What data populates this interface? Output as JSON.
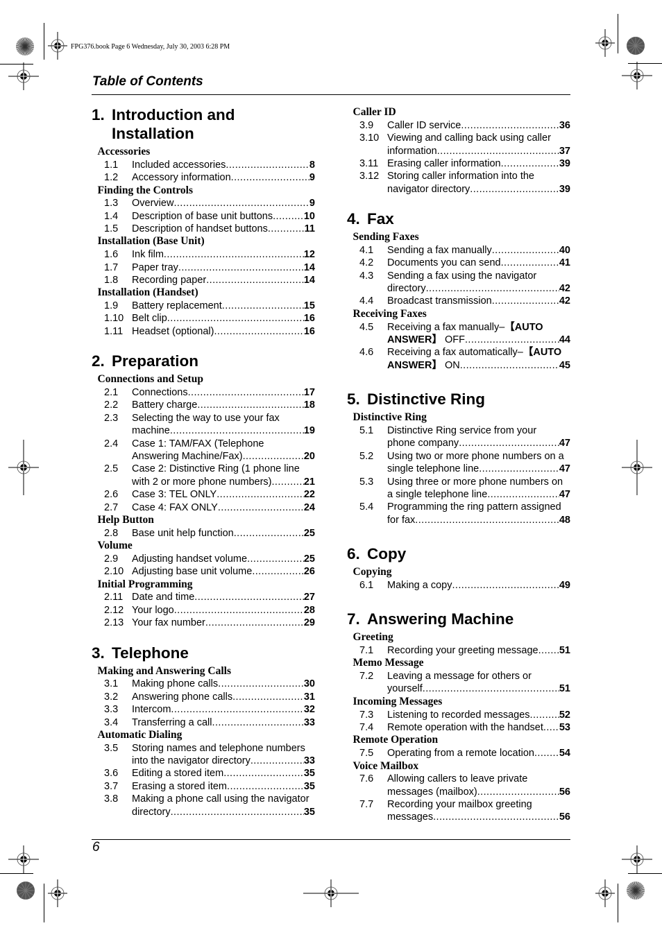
{
  "slug": "FPG376.book  Page 6  Wednesday, July 30, 2003  6:28 PM",
  "header": {
    "title": "Table of Contents"
  },
  "footer": {
    "page_number": "6"
  },
  "chapters": [
    {
      "number": "1.",
      "title_lines": [
        "Introduction and",
        "Installation"
      ],
      "sections": [
        {
          "title": "Accessories",
          "entries": [
            {
              "num": "1.1",
              "lines": [
                "Included accessories"
              ],
              "page": "8"
            },
            {
              "num": "1.2",
              "lines": [
                "Accessory information"
              ],
              "page": "9"
            }
          ]
        },
        {
          "title": "Finding the Controls",
          "entries": [
            {
              "num": "1.3",
              "lines": [
                "Overview"
              ],
              "page": "9"
            },
            {
              "num": "1.4",
              "lines": [
                "Description of base unit buttons"
              ],
              "page": "10"
            },
            {
              "num": "1.5",
              "lines": [
                "Description of handset buttons"
              ],
              "page": "11"
            }
          ]
        },
        {
          "title": "Installation (Base Unit)",
          "entries": [
            {
              "num": "1.6",
              "lines": [
                "Ink film"
              ],
              "page": "12"
            },
            {
              "num": "1.7",
              "lines": [
                "Paper tray"
              ],
              "page": "14"
            },
            {
              "num": "1.8",
              "lines": [
                "Recording paper"
              ],
              "page": "14"
            }
          ]
        },
        {
          "title": "Installation (Handset)",
          "entries": [
            {
              "num": "1.9",
              "lines": [
                "Battery replacement"
              ],
              "page": "15"
            },
            {
              "num": "1.10",
              "lines": [
                "Belt clip"
              ],
              "page": "16"
            },
            {
              "num": "1.11",
              "lines": [
                "Headset (optional)"
              ],
              "page": "16"
            }
          ]
        }
      ]
    },
    {
      "number": "2.",
      "title_lines": [
        "Preparation"
      ],
      "sections": [
        {
          "title": "Connections and Setup",
          "entries": [
            {
              "num": "2.1",
              "lines": [
                "Connections"
              ],
              "page": "17"
            },
            {
              "num": "2.2",
              "lines": [
                "Battery charge"
              ],
              "page": "18"
            },
            {
              "num": "2.3",
              "lines": [
                "Selecting the way to use your fax",
                "machine"
              ],
              "page": "19"
            },
            {
              "num": "2.4",
              "lines": [
                "Case 1: TAM/FAX (Telephone",
                "Answering Machine/Fax)"
              ],
              "page": "20"
            },
            {
              "num": "2.5",
              "lines": [
                "Case 2: Distinctive Ring (1 phone line",
                "with 2 or more phone numbers)"
              ],
              "page": "21"
            },
            {
              "num": "2.6",
              "lines": [
                "Case 3: TEL ONLY"
              ],
              "page": "22"
            },
            {
              "num": "2.7",
              "lines": [
                "Case 4: FAX ONLY"
              ],
              "page": "24"
            }
          ]
        },
        {
          "title": "Help Button",
          "entries": [
            {
              "num": "2.8",
              "lines": [
                "Base unit help function"
              ],
              "page": "25"
            }
          ]
        },
        {
          "title": "Volume",
          "entries": [
            {
              "num": "2.9",
              "lines": [
                "Adjusting handset volume"
              ],
              "page": "25"
            },
            {
              "num": "2.10",
              "lines": [
                "Adjusting base unit volume"
              ],
              "page": "26"
            }
          ]
        },
        {
          "title": "Initial Programming",
          "entries": [
            {
              "num": "2.11",
              "lines": [
                "Date and time"
              ],
              "page": "27"
            },
            {
              "num": "2.12",
              "lines": [
                "Your logo"
              ],
              "page": "28"
            },
            {
              "num": "2.13",
              "lines": [
                "Your fax number"
              ],
              "page": "29"
            }
          ]
        }
      ]
    },
    {
      "number": "3.",
      "title_lines": [
        "Telephone"
      ],
      "sections": [
        {
          "title": "Making and Answering Calls",
          "entries": [
            {
              "num": "3.1",
              "lines": [
                "Making phone calls"
              ],
              "page": "30"
            },
            {
              "num": "3.2",
              "lines": [
                "Answering phone calls"
              ],
              "page": "31"
            },
            {
              "num": "3.3",
              "lines": [
                "Intercom"
              ],
              "page": "32"
            },
            {
              "num": "3.4",
              "lines": [
                "Transferring a call"
              ],
              "page": "33"
            }
          ]
        },
        {
          "title": "Automatic Dialing",
          "entries": [
            {
              "num": "3.5",
              "lines": [
                "Storing names and telephone numbers",
                "into the navigator directory"
              ],
              "page": "33"
            },
            {
              "num": "3.6",
              "lines": [
                "Editing a stored item"
              ],
              "page": "35"
            },
            {
              "num": "3.7",
              "lines": [
                "Erasing a stored item"
              ],
              "page": "35"
            },
            {
              "num": "3.8",
              "lines": [
                "Making a phone call using the navigator",
                "directory"
              ],
              "page": "35"
            }
          ]
        },
        {
          "title": "Caller ID",
          "entries": [
            {
              "num": "3.9",
              "lines": [
                "Caller ID service"
              ],
              "page": "36"
            },
            {
              "num": "3.10",
              "lines": [
                "Viewing and calling back using caller",
                "information"
              ],
              "page": "37"
            },
            {
              "num": "3.11",
              "lines": [
                "Erasing caller information"
              ],
              "page": "39"
            },
            {
              "num": "3.12",
              "lines": [
                "Storing caller information into the",
                "navigator directory"
              ],
              "page": "39"
            }
          ]
        }
      ]
    },
    {
      "number": "4.",
      "title_lines": [
        "Fax"
      ],
      "sections": [
        {
          "title": "Sending Faxes",
          "entries": [
            {
              "num": "4.1",
              "lines": [
                "Sending a fax manually"
              ],
              "page": "40"
            },
            {
              "num": "4.2",
              "lines": [
                "Documents you can send"
              ],
              "page": "41"
            },
            {
              "num": "4.3",
              "lines": [
                "Sending a fax using the navigator",
                "directory"
              ],
              "page": "42"
            },
            {
              "num": "4.4",
              "lines": [
                "Broadcast transmission"
              ],
              "page": "42"
            }
          ]
        },
        {
          "title": "Receiving Faxes",
          "entries": [
            {
              "num": "4.5",
              "lines": [
                "Receiving a fax manually–{AUTO",
                "ANSWER} OFF"
              ],
              "page": "44"
            },
            {
              "num": "4.6",
              "lines": [
                "Receiving a fax automatically–{AUTO",
                "ANSWER} ON"
              ],
              "page": "45"
            }
          ]
        }
      ]
    },
    {
      "number": "5.",
      "title_lines": [
        "Distinctive Ring"
      ],
      "sections": [
        {
          "title": "Distinctive Ring",
          "entries": [
            {
              "num": "5.1",
              "lines": [
                "Distinctive Ring service from your",
                "phone company"
              ],
              "page": "47"
            },
            {
              "num": "5.2",
              "lines": [
                "Using two or more phone numbers on a",
                "single telephone line"
              ],
              "page": "47"
            },
            {
              "num": "5.3",
              "lines": [
                "Using three or more phone numbers on",
                "a single telephone line"
              ],
              "page": "47"
            },
            {
              "num": "5.4",
              "lines": [
                "Programming the ring pattern assigned",
                "for fax"
              ],
              "page": "48"
            }
          ]
        }
      ]
    },
    {
      "number": "6.",
      "title_lines": [
        "Copy"
      ],
      "sections": [
        {
          "title": "Copying",
          "entries": [
            {
              "num": "6.1",
              "lines": [
                "Making a copy"
              ],
              "page": "49"
            }
          ]
        }
      ]
    },
    {
      "number": "7.",
      "title_lines": [
        "Answering Machine"
      ],
      "sections": [
        {
          "title": "Greeting",
          "entries": [
            {
              "num": "7.1",
              "lines": [
                "Recording your greeting message"
              ],
              "page": "51"
            }
          ]
        },
        {
          "title": "Memo Message",
          "entries": [
            {
              "num": "7.2",
              "lines": [
                "Leaving a message for others or",
                "yourself"
              ],
              "page": "51"
            }
          ]
        },
        {
          "title": "Incoming Messages",
          "entries": [
            {
              "num": "7.3",
              "lines": [
                "Listening to recorded messages"
              ],
              "page": "52"
            },
            {
              "num": "7.4",
              "lines": [
                "Remote operation with the handset"
              ],
              "page": "53"
            }
          ]
        },
        {
          "title": "Remote Operation",
          "entries": [
            {
              "num": "7.5",
              "lines": [
                "Operating from a remote location"
              ],
              "page": "54"
            }
          ]
        },
        {
          "title": "Voice Mailbox",
          "entries": [
            {
              "num": "7.6",
              "lines": [
                "Allowing callers to leave private",
                "messages (mailbox)"
              ],
              "page": "56"
            },
            {
              "num": "7.7",
              "lines": [
                "Recording your mailbox greeting",
                "messages"
              ],
              "page": "56"
            }
          ]
        }
      ]
    }
  ],
  "printer_marks": {
    "registration_icon": "crosshair-registration-mark",
    "color_target_icon": "starburst-color-target"
  }
}
